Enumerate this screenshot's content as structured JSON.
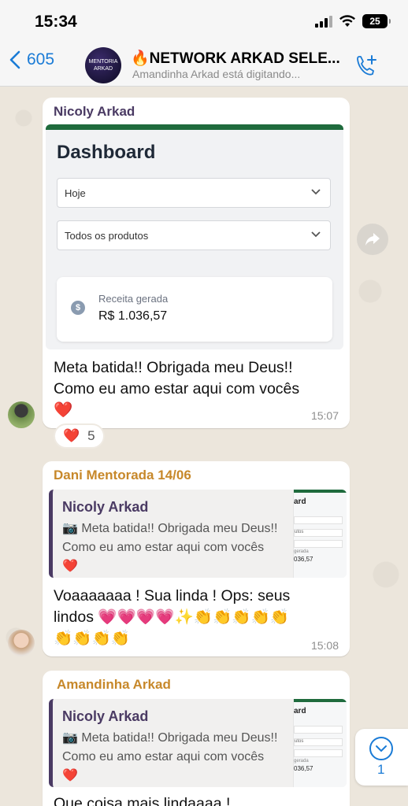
{
  "status_bar": {
    "time": "15:34",
    "battery": "25"
  },
  "header": {
    "back_count": "605",
    "avatar_text": "MENTORIA ARKAD",
    "title": "🔥NETWORK ARKAD SELE...",
    "subtitle": "Amandinha Arkad está digitando..."
  },
  "messages": [
    {
      "sender": "Nicoly Arkad",
      "sender_color": "#4a3a63",
      "dashboard": {
        "title": "Dashboard",
        "period": "Hoje",
        "products": "Todos os produtos",
        "revenue_label": "Receita gerada",
        "revenue_value": "R$ 1.036,57"
      },
      "text_line1": "Meta batida!! Obrigada meu Deus!!",
      "text_line2": "Como eu amo estar aqui com vocês",
      "text_line3": "❤️",
      "time": "15:07",
      "reaction": {
        "emoji": "❤️",
        "count": "5"
      }
    },
    {
      "sender": "Dani Mentorada 14/06",
      "sender_color": "#c7882a",
      "quote": {
        "name": "Nicoly Arkad",
        "text_line1": "📷 Meta batida!! Obrigada meu Deus!!",
        "text_line2": "Como eu amo estar aqui com vocês",
        "text_line3": "❤️"
      },
      "text_line1": "Voaaaaaaa ! Sua linda ! Ops: seus",
      "text_line2": "lindos 💗💗💗💗✨👏👏👏👏👏",
      "text_line3": "👏👏👏👏",
      "time": "15:08"
    },
    {
      "sender": "Amandinha Arkad",
      "sender_color": "#c7882a",
      "quote": {
        "name": "Nicoly Arkad",
        "text_line1": "📷 Meta batida!! Obrigada meu Deus!!",
        "text_line2": "Como eu amo estar aqui com vocês",
        "text_line3": "❤️"
      },
      "text_line1": "Que coisa mais lindaaaa !"
    }
  ],
  "thumb": {
    "title": "ard",
    "l1": "",
    "l2": "utos",
    "gerada": "gerada",
    "value": "036,57"
  },
  "scroll_down": {
    "count": "1"
  },
  "colors": {
    "accent": "#1a7bd6",
    "dashboard_green": "#1f6b3d",
    "chat_bg": "#efeae2"
  }
}
